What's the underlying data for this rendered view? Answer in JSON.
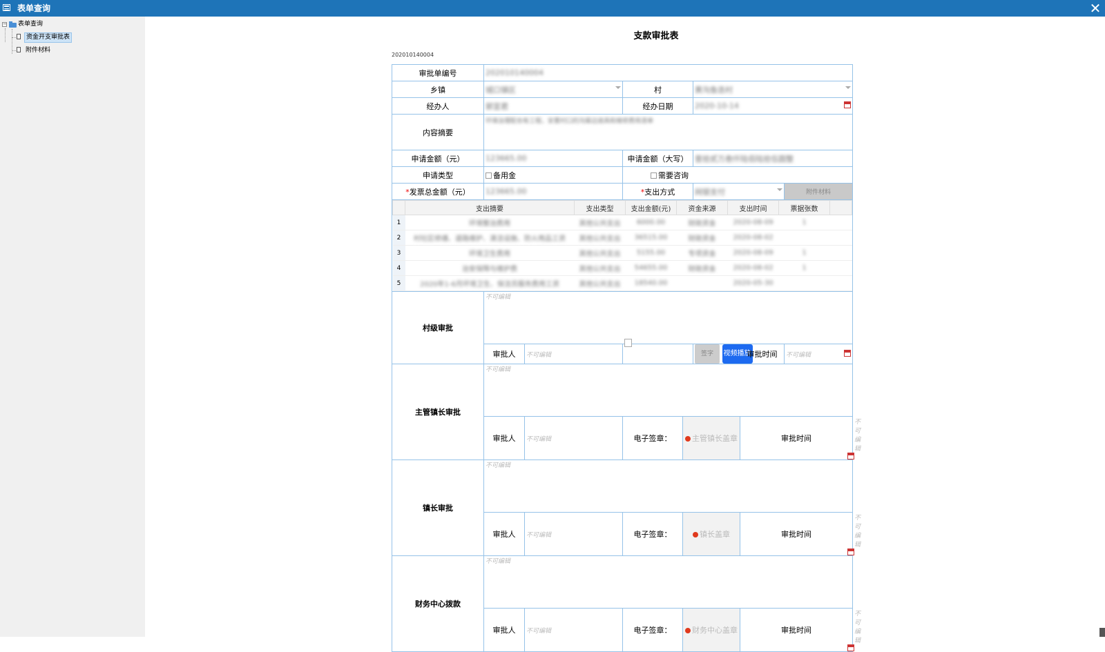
{
  "window": {
    "title": "表单查询",
    "close_glyph": "✕"
  },
  "sidebar": {
    "root": {
      "label": "表单查询",
      "toggle": "−"
    },
    "items": [
      {
        "label": "资金开支审批表",
        "selected": true
      },
      {
        "label": "附件材料",
        "selected": false
      }
    ]
  },
  "form": {
    "title": "支款审批表",
    "number": "202010140004",
    "labels": {
      "approval_no": "审批单编号",
      "township": "乡镇",
      "village": "村",
      "handler": "经办人",
      "handle_date": "经办日期",
      "summary": "内容摘要",
      "amount": "申请金额（元）",
      "amount_upper": "申请金额（大写）",
      "apply_type": "申请类型",
      "invoice_total": "发票总金额（元）",
      "pay_method": "支出方式",
      "required_mark": "*"
    },
    "values": {
      "approval_no": "202010140004",
      "township": "城口镇区",
      "village": "黄沟鱼迭村",
      "handler": "郭宣君",
      "handle_date": "2020-10-14",
      "summary": "环境治理配合有工程，安置村口的沟渠边道具和维修费用清单",
      "amount": "123665.00",
      "amount_upper": "壹拾贰万叁仟陆佰陆拾伍圆整",
      "invoice_total": "123665.00",
      "pay_method": "网银支付"
    },
    "apply_type_options": [
      "备用金",
      "需要咨询"
    ],
    "attach_button": "附件材料"
  },
  "expenses": {
    "headers": [
      "支出摘要",
      "支出类型",
      "支出金额(元)",
      "资金来源",
      "支出时间",
      "票据张数"
    ],
    "rows": [
      {
        "n": "1",
        "summary": "环境整治费用",
        "type": "其他公共支出",
        "amount": "6000.00",
        "source": "财政资金",
        "date": "2020-08-09",
        "tickets": "1"
      },
      {
        "n": "2",
        "summary": "村社区修缮、道路维护、清洁设施、防火用品工资",
        "type": "其他公共支出",
        "amount": "36515.00",
        "source": "财政资金",
        "date": "2020-08-02",
        "tickets": ""
      },
      {
        "n": "3",
        "summary": "环境卫生费用",
        "type": "其他公共支出",
        "amount": "5155.00",
        "source": "专项资金",
        "date": "2020-08-09",
        "tickets": "1"
      },
      {
        "n": "4",
        "summary": "治安保障与维护费",
        "type": "其他公共支出",
        "amount": "54655.00",
        "source": "财政资金",
        "date": "2020-08-02",
        "tickets": "1"
      },
      {
        "n": "5",
        "summary": "2020年1-6月环境卫生、保洁员服务费用工资",
        "type": "其他公共支出",
        "amount": "18540.00",
        "source": "",
        "date": "2020-05-30",
        "tickets": ""
      }
    ]
  },
  "approvals": {
    "not_editable": "不可编辑",
    "approver_label": "审批人",
    "time_label": "审批时间",
    "seal_label": "电子签章：",
    "village": {
      "title": "村级审批",
      "sign_button": "签字",
      "video_button": "视频播放"
    },
    "supervisor": {
      "title": "主管镇长审批",
      "seal": "主管镇长盖章"
    },
    "mayor": {
      "title": "镇长审批",
      "seal": "镇长盖章"
    },
    "finance": {
      "title": "财务中心拨款",
      "seal": "财务中心盖章"
    }
  },
  "colors": {
    "titlebar": "#1e74b8",
    "border": "#95c2e8",
    "video_button": "#1d6af0"
  }
}
